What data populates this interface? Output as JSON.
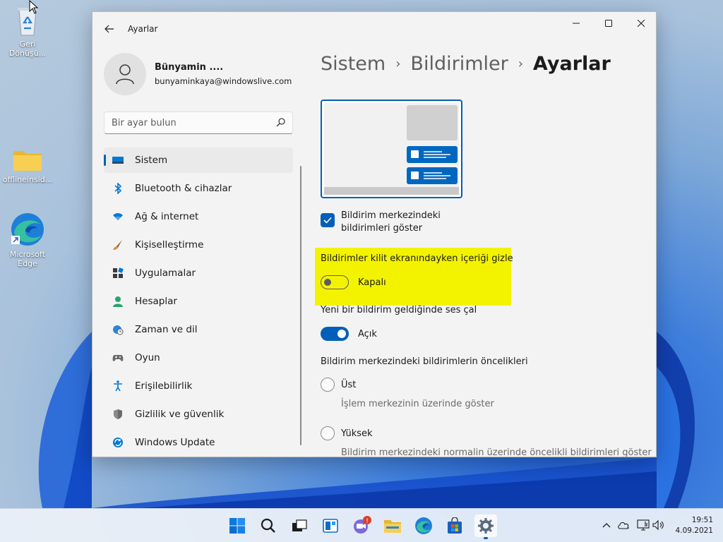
{
  "desktop": {
    "icons": [
      {
        "label": "Geri Dönüşü...",
        "icon": "recycle-bin-icon"
      },
      {
        "label": "offlineinsid...",
        "icon": "folder-icon"
      },
      {
        "label": "Microsoft Edge",
        "icon": "edge-icon"
      }
    ]
  },
  "window": {
    "app_title": "Ayarlar",
    "controls": {
      "minimize": "minimize-icon",
      "maximize": "maximize-icon",
      "close": "close-icon"
    }
  },
  "profile": {
    "name": "Bünyamin ....",
    "email": "bunyaminkaya@windowslive.com"
  },
  "search": {
    "placeholder": "Bir ayar bulun",
    "value": ""
  },
  "sidebar": {
    "items": [
      {
        "label": "Sistem",
        "icon": "system-icon",
        "active": true
      },
      {
        "label": "Bluetooth & cihazlar",
        "icon": "bluetooth-icon"
      },
      {
        "label": "Ağ & internet",
        "icon": "wifi-icon"
      },
      {
        "label": "Kişiselleştirme",
        "icon": "brush-icon"
      },
      {
        "label": "Uygulamalar",
        "icon": "apps-icon"
      },
      {
        "label": "Hesaplar",
        "icon": "account-icon"
      },
      {
        "label": "Zaman ve dil",
        "icon": "globe-clock-icon"
      },
      {
        "label": "Oyun",
        "icon": "gamepad-icon"
      },
      {
        "label": "Erişilebilirlik",
        "icon": "accessibility-icon"
      },
      {
        "label": "Gizlilik ve güvenlik",
        "icon": "shield-icon"
      },
      {
        "label": "Windows Update",
        "icon": "update-icon"
      }
    ]
  },
  "breadcrumb": {
    "parts": [
      "Sistem",
      "Bildirimler"
    ],
    "current": "Ayarlar"
  },
  "settings": {
    "show_in_center_label": "Bildirim merkezindeki bildirimleri göster",
    "show_in_center_checked": true,
    "hide_on_lock_label": "Bildirimler kilit ekranındayken içeriği gizle",
    "hide_on_lock_state": "Kapalı",
    "hide_on_lock_on": false,
    "play_sound_label": "Yeni bir bildirim geldiğinde ses çal",
    "play_sound_state": "Açık",
    "play_sound_on": true,
    "priority_heading": "Bildirim merkezindeki bildirimlerin öncelikleri",
    "priority_options": [
      {
        "label": "Üst",
        "description": "İşlem merkezinin üzerinde göster"
      },
      {
        "label": "Yüksek",
        "description": "Bildirim merkezindeki normalin üzerinde öncelikli bildirimleri göster"
      }
    ],
    "highlight_color": "#f3f300",
    "accent_color": "#005fb8"
  },
  "taskbar": {
    "pinned": [
      "start-icon",
      "search-icon",
      "task-view-icon",
      "widgets-icon",
      "chat-icon",
      "file-explorer-icon",
      "edge-icon",
      "store-icon",
      "settings-icon"
    ],
    "chat_badge": "!",
    "tray": [
      "chevron-up-icon",
      "onedrive-icon",
      "network-icon",
      "volume-icon"
    ],
    "time": "19:51",
    "date": "4.09.2021"
  }
}
